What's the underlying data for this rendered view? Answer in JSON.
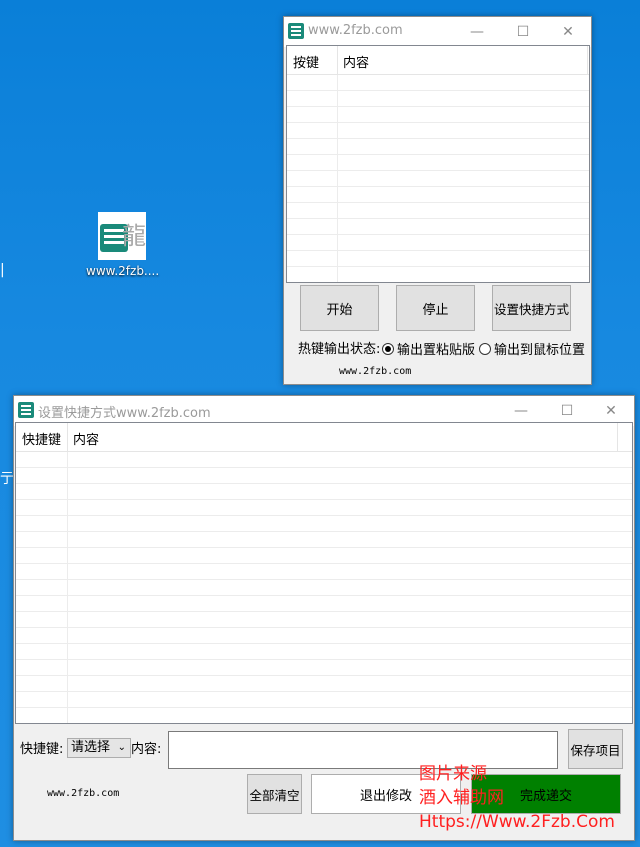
{
  "desktop": {
    "icon_label": "www.2fzb...."
  },
  "main_window": {
    "title": "www.2fzb.com",
    "controls": {
      "minimize": "—",
      "maximize": "☐",
      "close": "✕"
    },
    "columns": [
      "按键",
      "内容"
    ],
    "buttons": {
      "start": "开始",
      "stop": "停止",
      "set_hotkey": "设置快捷方式"
    },
    "status_label": "热键输出状态:",
    "radio_clipboard": "输出置粘贴版",
    "radio_mouse": "输出到鼠标位置",
    "footer": "www.2fzb.com"
  },
  "dialog": {
    "title": "设置快捷方式www.2fzb.com",
    "controls": {
      "minimize": "—",
      "maximize": "☐",
      "close": "✕"
    },
    "columns": [
      "快捷键",
      "内容"
    ],
    "hotkey_label": "快捷键:",
    "hotkey_select": "请选择",
    "content_label": "内容:",
    "content_value": "",
    "save_item": "保存项目",
    "clear_all": "全部清空",
    "exit_edit": "退出修改",
    "finish_submit": "完成递交",
    "footer": "www.2fzb.com",
    "finish_color": "#008000"
  },
  "watermark": {
    "line1": "图片来源",
    "line2": "酒入辅助网",
    "line3": "Https://Www.2Fzb.Com"
  }
}
